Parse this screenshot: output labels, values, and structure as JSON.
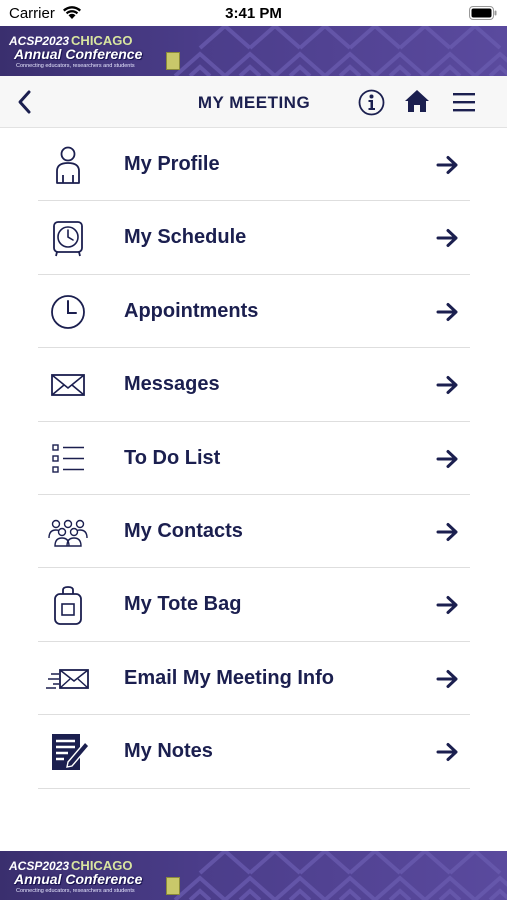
{
  "status_bar": {
    "carrier": "Carrier",
    "time": "3:41 PM"
  },
  "banner": {
    "acsp": "ACSP2023",
    "city": "CHICAGO",
    "title": "Annual Conference",
    "tagline": "Connecting educators, researchers and students"
  },
  "nav": {
    "title": "MY MEETING",
    "icons": [
      "back-icon",
      "info-icon",
      "home-icon",
      "menu-icon"
    ]
  },
  "menu": {
    "items": [
      {
        "label": "My Profile",
        "icon": "person-icon"
      },
      {
        "label": "My Schedule",
        "icon": "alarm-clock-icon"
      },
      {
        "label": "Appointments",
        "icon": "clock-icon"
      },
      {
        "label": "Messages",
        "icon": "envelope-icon"
      },
      {
        "label": "To Do List",
        "icon": "checklist-icon"
      },
      {
        "label": "My Contacts",
        "icon": "group-icon"
      },
      {
        "label": "My Tote Bag",
        "icon": "tote-bag-icon"
      },
      {
        "label": "Email My Meeting Info",
        "icon": "send-email-icon"
      },
      {
        "label": "My Notes",
        "icon": "notes-icon"
      }
    ]
  },
  "colors": {
    "primary": "#1b1f4f",
    "banner": "#4b3d8a",
    "divider": "#dedede"
  }
}
